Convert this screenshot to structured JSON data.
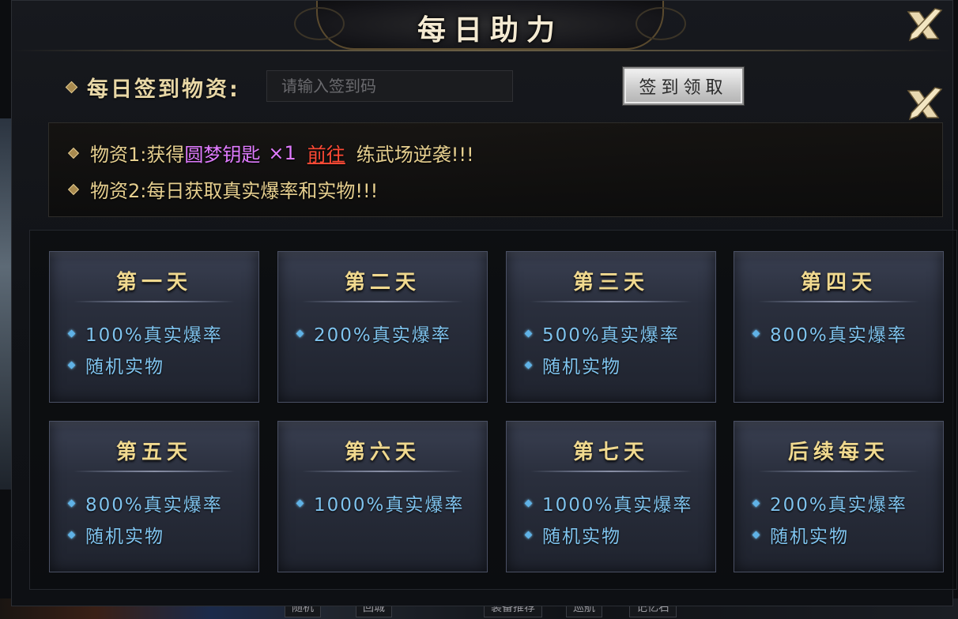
{
  "title": "每日助力",
  "sign": {
    "label": "每日签到物资:",
    "input_placeholder": "请输入签到码",
    "input_value": "",
    "button_label": "签到领取"
  },
  "info": {
    "line1_prefix": "物资1:获得",
    "line1_item": "圆梦钥匙",
    "line1_qty": "×1",
    "line1_link": "前往",
    "line1_suffix": "练武场逆袭!!!",
    "line2": "物资2:每日获取真实爆率和实物!!!"
  },
  "colors": {
    "item_purple": "#e07bff",
    "link_red": "#ff4a35",
    "gold_text": "#e6cf8f",
    "reward_blue": "#7fc3ee",
    "card_title": "#f0d98f"
  },
  "days": [
    {
      "title": "第一天",
      "items": [
        "100%真实爆率",
        "随机实物"
      ]
    },
    {
      "title": "第二天",
      "items": [
        "200%真实爆率"
      ]
    },
    {
      "title": "第三天",
      "items": [
        "500%真实爆率",
        "随机实物"
      ]
    },
    {
      "title": "第四天",
      "items": [
        "800%真实爆率"
      ]
    },
    {
      "title": "第五天",
      "items": [
        "800%真实爆率",
        "随机实物"
      ]
    },
    {
      "title": "第六天",
      "items": [
        "1000%真实爆率"
      ]
    },
    {
      "title": "第七天",
      "items": [
        "1000%真实爆率",
        "随机实物"
      ]
    },
    {
      "title": "后续每天",
      "items": [
        "200%真实爆率",
        "随机实物"
      ]
    }
  ],
  "icons": {
    "close": "crossed-swords-close-icon",
    "bullet": "diamond-bullet-icon"
  },
  "background_bottom_labels": [
    "随机",
    "回城",
    "装备推荐",
    "巡航",
    "记忆石"
  ]
}
